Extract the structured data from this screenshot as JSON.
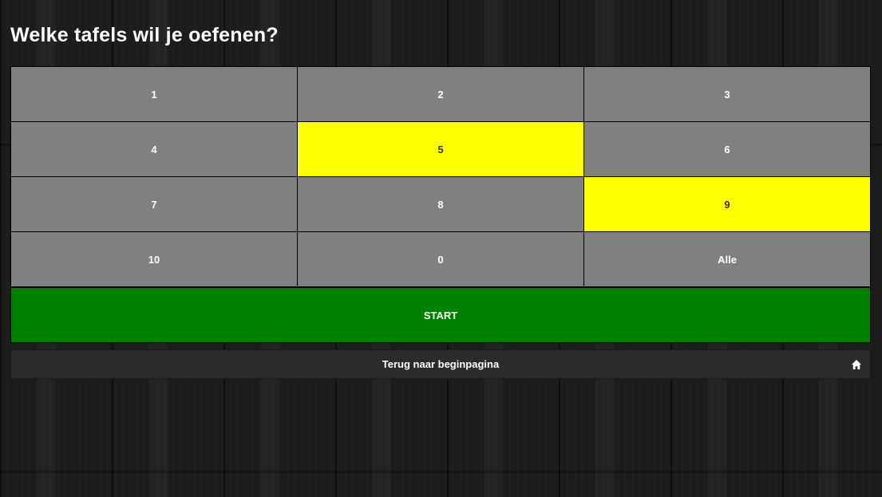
{
  "page": {
    "title": "Welke tafels wil je oefenen?"
  },
  "tables": [
    {
      "label": "1",
      "selected": false
    },
    {
      "label": "2",
      "selected": false
    },
    {
      "label": "3",
      "selected": false
    },
    {
      "label": "4",
      "selected": false
    },
    {
      "label": "5",
      "selected": true
    },
    {
      "label": "6",
      "selected": false
    },
    {
      "label": "7",
      "selected": false
    },
    {
      "label": "8",
      "selected": false
    },
    {
      "label": "9",
      "selected": true
    },
    {
      "label": "10",
      "selected": false
    },
    {
      "label": "0",
      "selected": false
    },
    {
      "label": "Alle",
      "selected": false
    }
  ],
  "start_button": {
    "label": "START"
  },
  "back_button": {
    "label": "Terug naar beginpagina",
    "icon": "home-icon"
  },
  "colors": {
    "tile_default": "#808080",
    "tile_selected": "#ffff00",
    "start": "#008000",
    "back_bar": "#2b2b2b"
  }
}
